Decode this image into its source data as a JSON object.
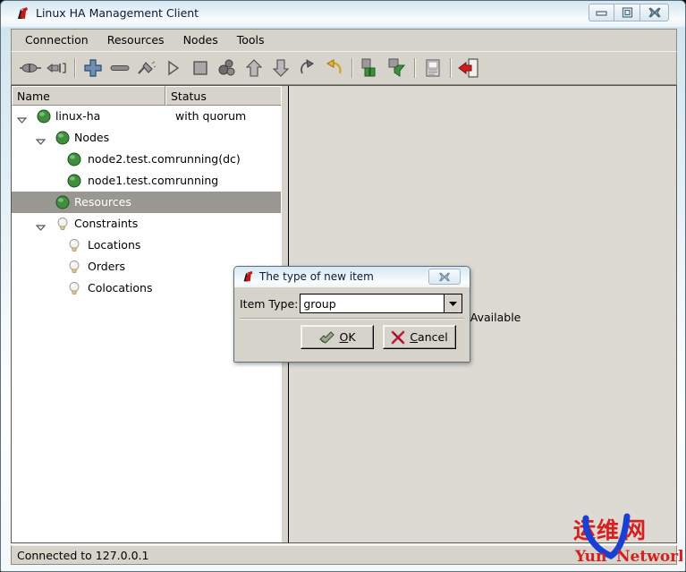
{
  "window": {
    "title": "Linux HA Management Client",
    "app_icon": "linux-ha-icon",
    "controls": {
      "minimize": "minimize-button",
      "maximize": "maximize-button",
      "close": "close-button"
    }
  },
  "menubar": {
    "items": [
      {
        "label": "Connection"
      },
      {
        "label": "Resources"
      },
      {
        "label": "Nodes"
      },
      {
        "label": "Tools"
      }
    ]
  },
  "toolbar": {
    "buttons": [
      {
        "name": "connect-icon"
      },
      {
        "name": "disconnect-icon"
      },
      {
        "name": "separator"
      },
      {
        "name": "add-icon"
      },
      {
        "name": "remove-icon"
      },
      {
        "name": "cleanup-icon"
      },
      {
        "name": "start-icon"
      },
      {
        "name": "stop-icon"
      },
      {
        "name": "migrate-icon"
      },
      {
        "name": "up-arrow-icon"
      },
      {
        "name": "down-arrow-icon"
      },
      {
        "name": "refresh-icon"
      },
      {
        "name": "undo-icon"
      },
      {
        "name": "separator"
      },
      {
        "name": "standby-node-icon"
      },
      {
        "name": "activate-node-icon"
      },
      {
        "name": "separator"
      },
      {
        "name": "document-icon"
      },
      {
        "name": "separator"
      },
      {
        "name": "exit-icon"
      }
    ]
  },
  "tree": {
    "columns": [
      {
        "label": "Name",
        "key": "name"
      },
      {
        "label": "Status",
        "key": "status"
      }
    ],
    "rows": [
      {
        "label": "linux-ha",
        "status": "with quorum",
        "icon": "green-ball-icon",
        "indent": 0,
        "toggle": "expanded",
        "selected": false
      },
      {
        "label": "Nodes",
        "status": "",
        "icon": "green-ball-icon",
        "indent": 1,
        "toggle": "expanded",
        "selected": false
      },
      {
        "label": "node2.test.com",
        "status": "running(dc)",
        "icon": "green-ball-icon",
        "indent": 2,
        "toggle": "none",
        "selected": false
      },
      {
        "label": "node1.test.com",
        "status": "running",
        "icon": "green-ball-icon",
        "indent": 2,
        "toggle": "none",
        "selected": false
      },
      {
        "label": "Resources",
        "status": "",
        "icon": "green-ball-icon",
        "indent": 1,
        "toggle": "none",
        "selected": true
      },
      {
        "label": "Constraints",
        "status": "",
        "icon": "bulb-icon",
        "indent": 1,
        "toggle": "expanded",
        "selected": false
      },
      {
        "label": "Locations",
        "status": "",
        "icon": "bulb-icon",
        "indent": 2,
        "toggle": "none",
        "selected": false
      },
      {
        "label": "Orders",
        "status": "",
        "icon": "bulb-icon",
        "indent": 2,
        "toggle": "none",
        "selected": false
      },
      {
        "label": "Colocations",
        "status": "",
        "icon": "bulb-icon",
        "indent": 2,
        "toggle": "none",
        "selected": false
      }
    ]
  },
  "detail": {
    "message": "No Data Available"
  },
  "dialog": {
    "icon": "linux-ha-icon",
    "title": "The type of new item",
    "close_label": "close-button",
    "field_label": "Item Type:",
    "field_value": "group",
    "field_placeholder": "",
    "dropdown_icon": "chevron-down-icon",
    "ok": {
      "prefix": "",
      "accel": "O",
      "suffix": "K",
      "icon": "ok-check-icon"
    },
    "cancel": {
      "prefix": "",
      "accel": "C",
      "suffix": "ancel",
      "icon": "cancel-x-icon"
    }
  },
  "statusbar": {
    "text": "Connected to 127.0.0.1"
  },
  "watermark": {
    "chinese": "运维网",
    "latin_left": "Yun",
    "latin_right": "Network",
    "color_red": "#d42020",
    "color_blue": "#1a3fd4"
  },
  "colors": {
    "window_chrome": "#d6d3cb",
    "tree_background": "#ffffff",
    "selection": "#999792",
    "detail_background": "#dcdad3",
    "status_green": "#3f8f3f"
  }
}
